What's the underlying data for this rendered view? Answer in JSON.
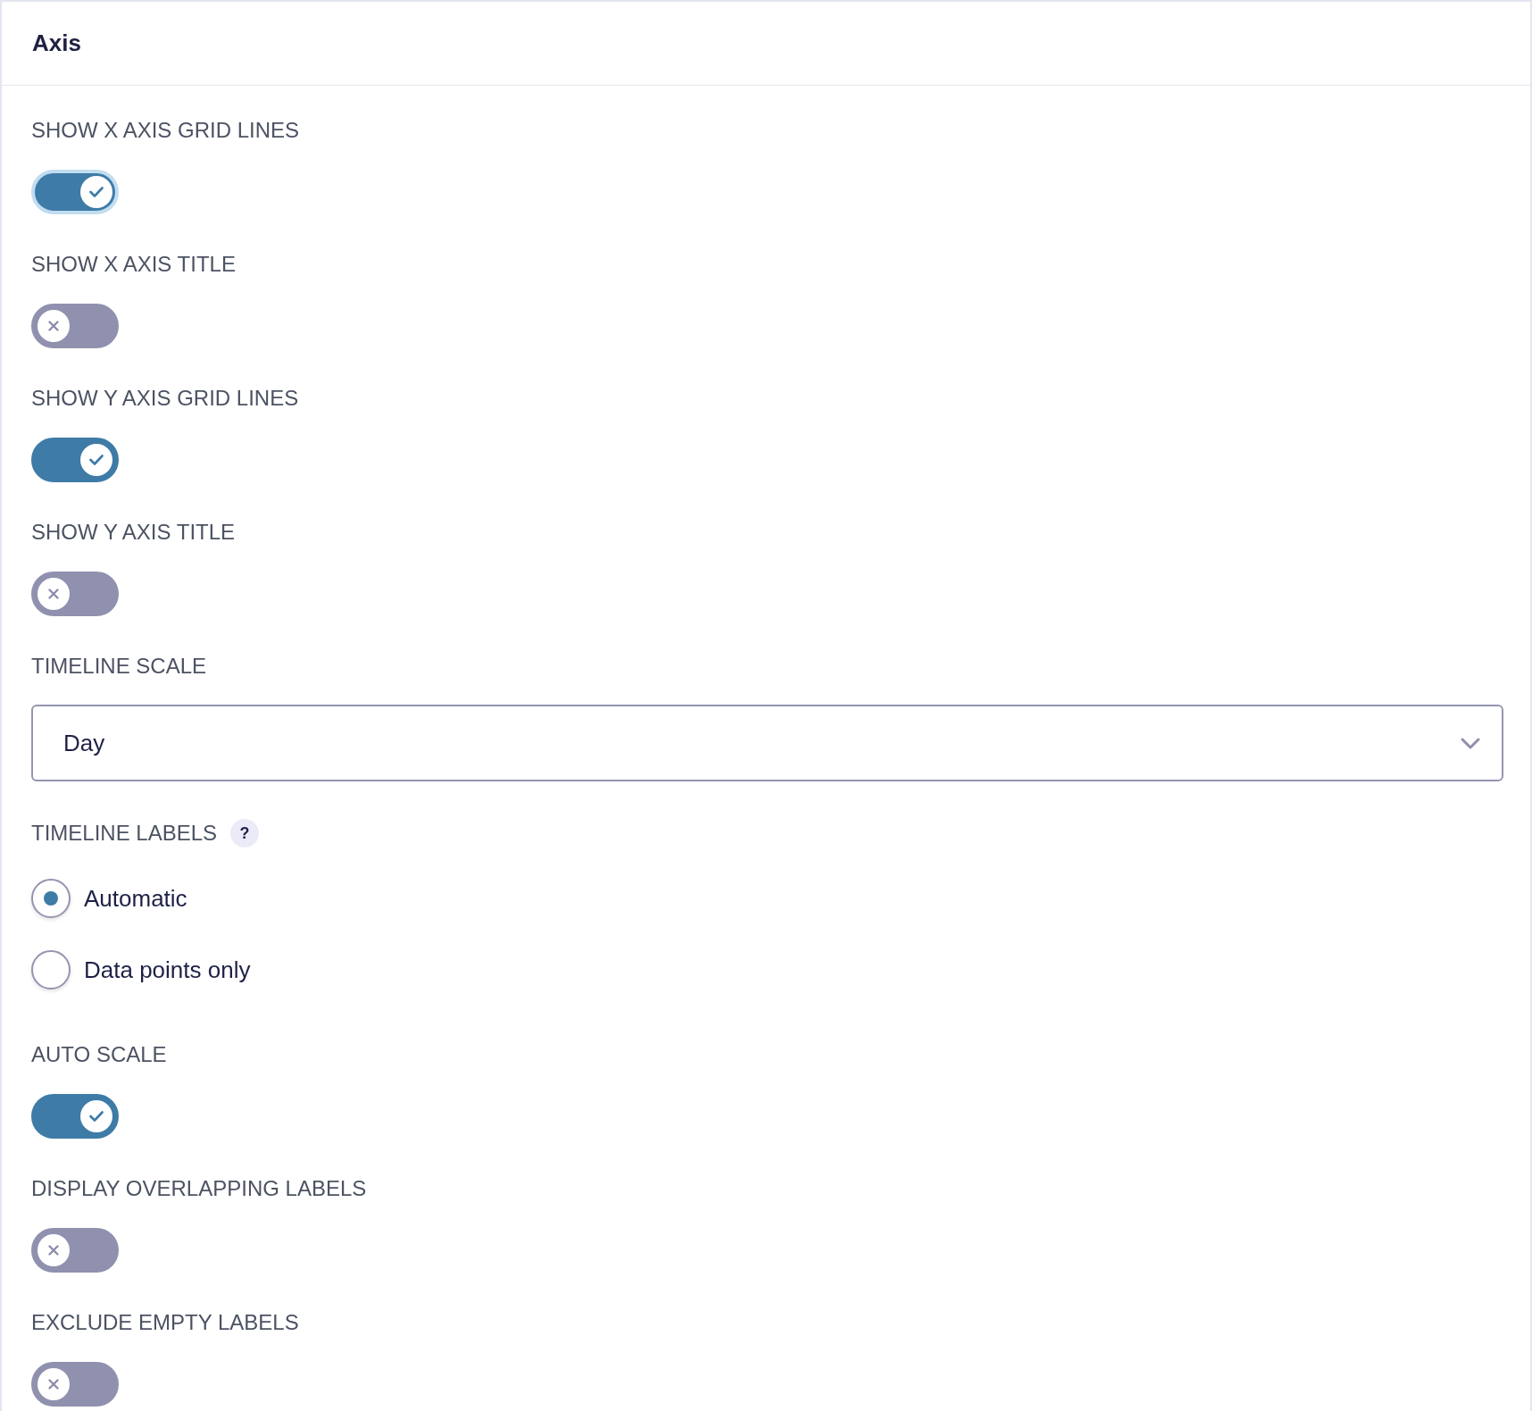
{
  "panel": {
    "title": "Axis"
  },
  "fields": [
    {
      "kind": "toggle",
      "label": "SHOW X AXIS GRID LINES",
      "on": true,
      "focused": true
    },
    {
      "kind": "toggle",
      "label": "SHOW X AXIS TITLE",
      "on": false,
      "focused": false
    },
    {
      "kind": "toggle",
      "label": "SHOW Y AXIS GRID LINES",
      "on": true,
      "focused": false
    },
    {
      "kind": "toggle",
      "label": "SHOW Y AXIS TITLE",
      "on": false,
      "focused": false
    },
    {
      "kind": "select",
      "label": "TIMELINE SCALE",
      "value": "Day"
    },
    {
      "kind": "radio",
      "label": "TIMELINE LABELS",
      "help": "?",
      "options": [
        {
          "label": "Automatic",
          "selected": true
        },
        {
          "label": "Data points only",
          "selected": false
        }
      ]
    },
    {
      "kind": "toggle",
      "label": "AUTO SCALE",
      "on": true,
      "focused": false
    },
    {
      "kind": "toggle",
      "label": "DISPLAY OVERLAPPING LABELS",
      "on": false,
      "focused": false
    },
    {
      "kind": "toggle",
      "label": "EXCLUDE EMPTY LABELS",
      "on": false,
      "focused": false
    }
  ]
}
